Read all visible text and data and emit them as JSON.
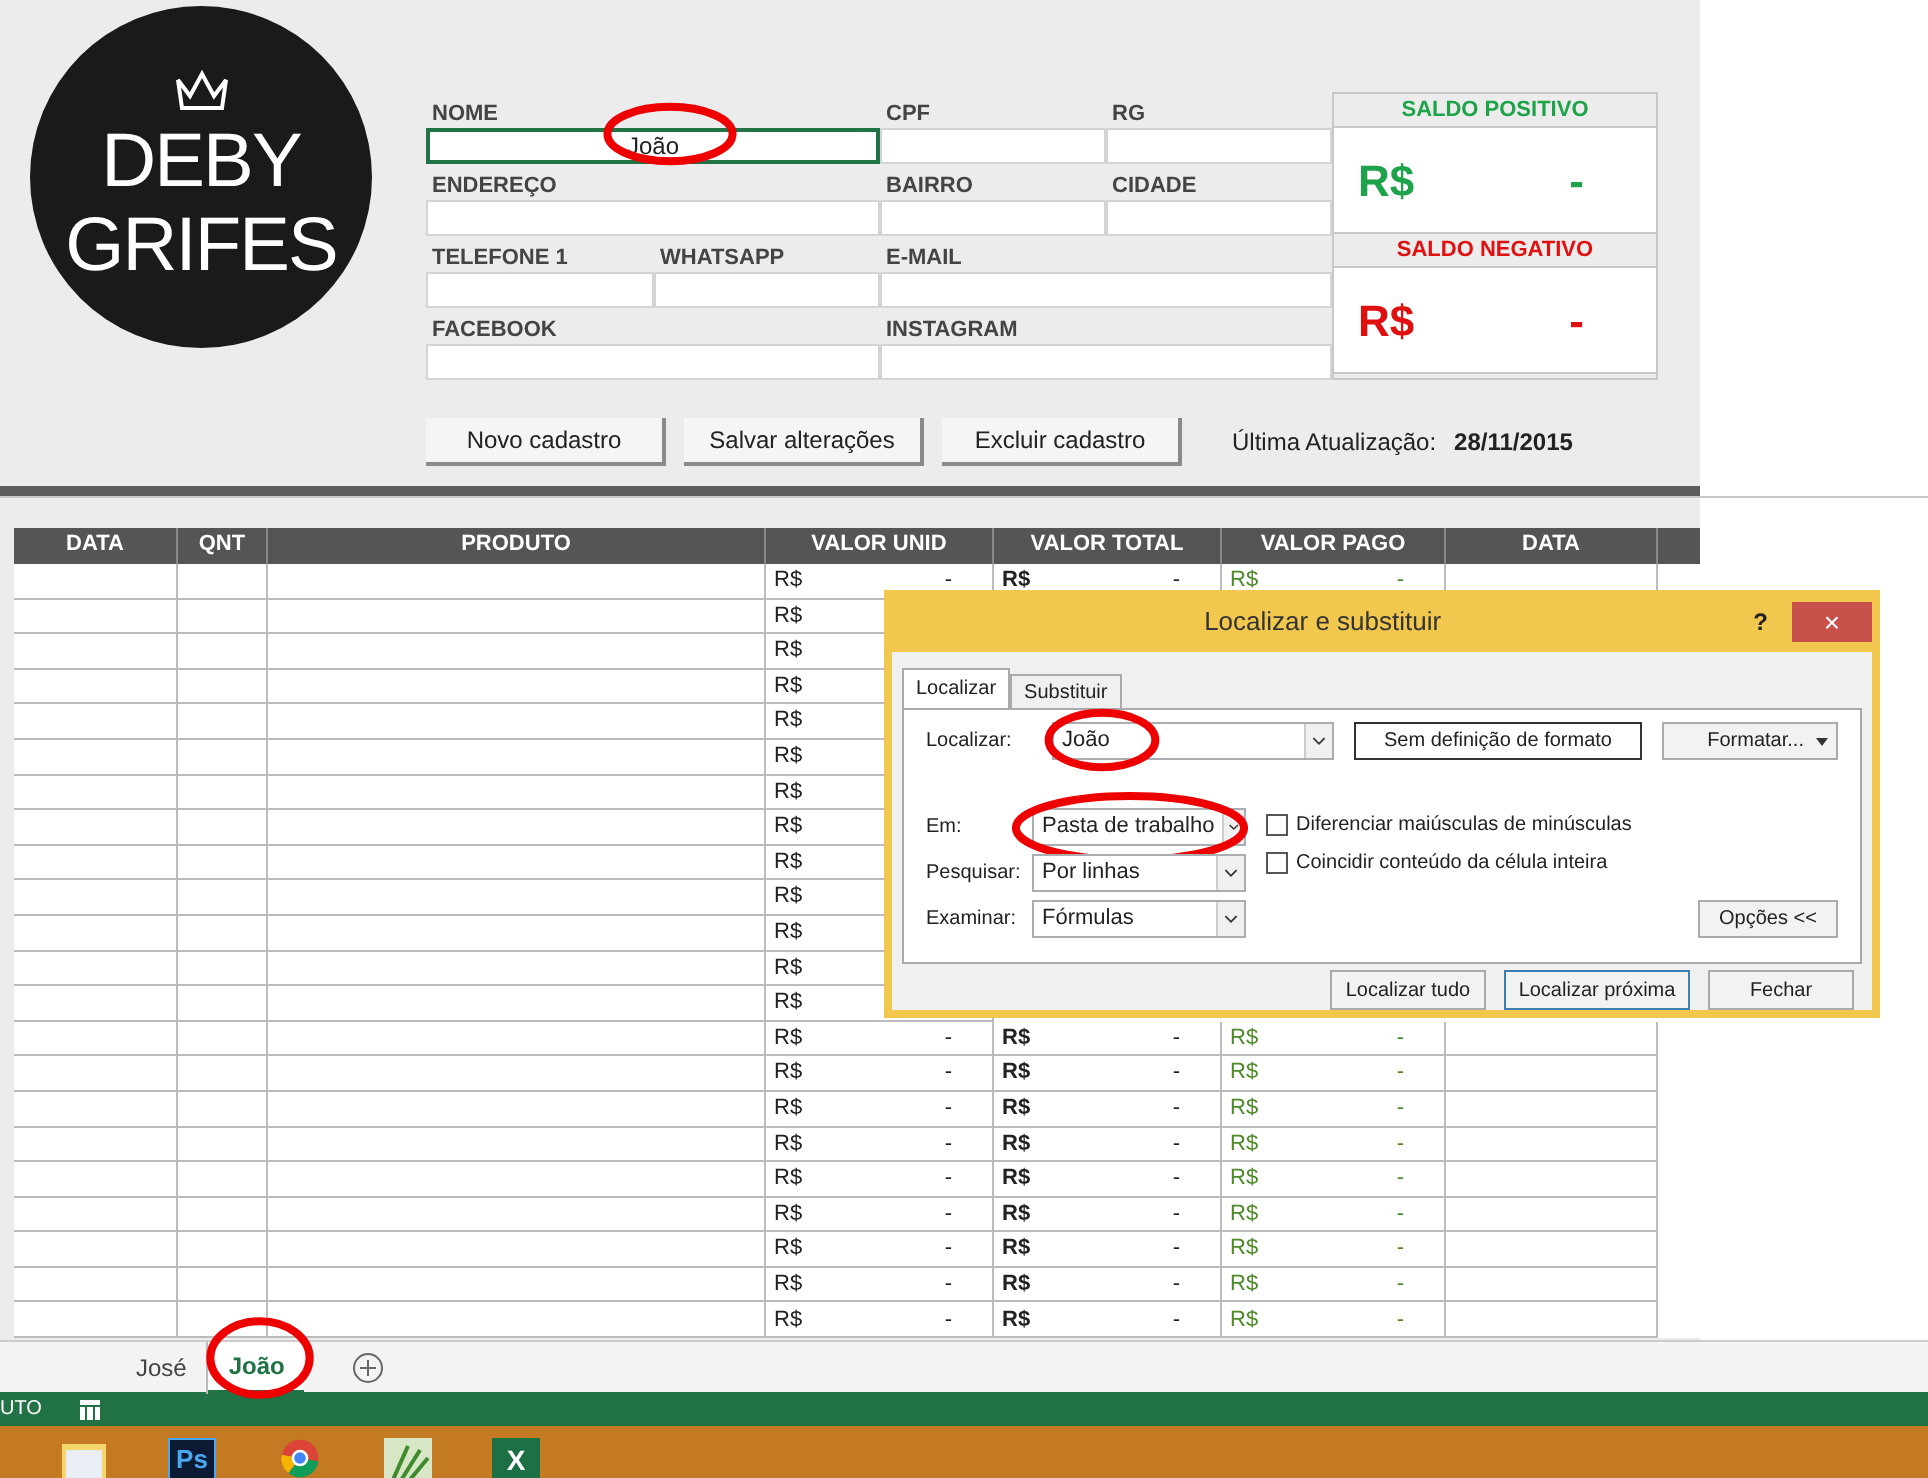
{
  "logo": {
    "lines": [
      "DEBY",
      "GRIFES"
    ]
  },
  "form": {
    "rows": [
      {
        "fields": [
          {
            "label": "NOME",
            "value": "João",
            "selected": true
          },
          {
            "label": "CPF",
            "selected": false
          },
          {
            "label": "RG",
            "selected": false
          }
        ]
      },
      {
        "fields": [
          {
            "label": "ENDEREÇO",
            "selected": false
          },
          {
            "label": "BAIRRO",
            "selected": false
          },
          {
            "label": "CIDADE",
            "selected": false
          }
        ]
      },
      {
        "fields": [
          {
            "label": "TELEFONE 1",
            "selected": false
          },
          {
            "label": "WHATSAPP",
            "selected": false
          },
          {
            "label": "E-MAIL",
            "selected": false
          }
        ]
      },
      {
        "fields": [
          {
            "label": "FACEBOOK",
            "selected": false
          },
          {
            "label": "INSTAGRAM",
            "selected": false
          }
        ]
      }
    ]
  },
  "balances": [
    {
      "title": "SALDO POSITIVO",
      "currency": "R$",
      "value": "-",
      "color": "#1fa34a"
    },
    {
      "title": "SALDO NEGATIVO",
      "currency": "R$",
      "value": "-",
      "color": "#e01010"
    }
  ],
  "buttons": [
    "Novo cadastro",
    "Salvar alterações",
    "Excluir cadastro"
  ],
  "last_update": {
    "label": "Última Atualização:",
    "date": "28/11/2015"
  },
  "table": {
    "columns": [
      "DATA",
      "QNT",
      "PRODUTO",
      "VALOR UNID",
      "VALOR TOTAL",
      "VALOR PAGO",
      "DATA"
    ],
    "rows": [
      {
        "unid": [
          "R$",
          "-"
        ],
        "total": [
          "R$",
          "-"
        ],
        "pago": [
          "R$",
          "-"
        ]
      },
      {
        "unid": [
          "R$"
        ]
      },
      {
        "unid": [
          "R$"
        ]
      },
      {
        "unid": [
          "R$"
        ]
      },
      {
        "unid": [
          "R$"
        ]
      },
      {
        "unid": [
          "R$"
        ]
      },
      {
        "unid": [
          "R$"
        ]
      },
      {
        "unid": [
          "R$"
        ]
      },
      {
        "unid": [
          "R$"
        ]
      },
      {
        "unid": [
          "R$"
        ]
      },
      {
        "unid": [
          "R$"
        ]
      },
      {
        "unid": [
          "R$"
        ]
      },
      {
        "unid": [
          "R$"
        ]
      },
      {
        "unid": [
          "R$",
          "-"
        ],
        "total": [
          "R$",
          "-"
        ],
        "pago": [
          "R$",
          "-"
        ]
      },
      {
        "unid": [
          "R$",
          "-"
        ],
        "total": [
          "R$",
          "-"
        ],
        "pago": [
          "R$",
          "-"
        ]
      },
      {
        "unid": [
          "R$",
          "-"
        ],
        "total": [
          "R$",
          "-"
        ],
        "pago": [
          "R$",
          "-"
        ]
      },
      {
        "unid": [
          "R$",
          "-"
        ],
        "total": [
          "R$",
          "-"
        ],
        "pago": [
          "R$",
          "-"
        ]
      },
      {
        "unid": [
          "R$",
          "-"
        ],
        "total": [
          "R$",
          "-"
        ],
        "pago": [
          "R$",
          "-"
        ]
      },
      {
        "unid": [
          "R$",
          "-"
        ],
        "total": [
          "R$",
          "-"
        ],
        "pago": [
          "R$",
          "-"
        ]
      },
      {
        "unid": [
          "R$",
          "-"
        ],
        "total": [
          "R$",
          "-"
        ],
        "pago": [
          "R$",
          "-"
        ]
      },
      {
        "unid": [
          "R$",
          "-"
        ],
        "total": [
          "R$",
          "-"
        ],
        "pago": [
          "R$",
          "-"
        ]
      },
      {
        "unid": [
          "R$",
          "-"
        ],
        "total": [
          "R$",
          "-"
        ],
        "pago": [
          "R$",
          "-"
        ]
      }
    ]
  },
  "dialog": {
    "title": "Localizar e substituir",
    "help": "?",
    "close": "×",
    "tabs": [
      {
        "label": "Localizar",
        "selected": true
      },
      {
        "label": "Substituir",
        "selected": false
      }
    ],
    "find": {
      "label": "Localizar:",
      "value": "João"
    },
    "format_status": "Sem definição de formato",
    "format_button": "Formatar...",
    "options": [
      {
        "label": "Em:",
        "value": "Pasta de trabalho"
      },
      {
        "label": "Pesquisar:",
        "value": "Por linhas"
      },
      {
        "label": "Examinar:",
        "value": "Fórmulas"
      }
    ],
    "checkboxes": [
      {
        "label": "Diferenciar maiúsculas de minúsculas",
        "checked": false
      },
      {
        "label": "Coincidir conteúdo da célula inteira",
        "checked": false
      }
    ],
    "options_button": "Opções <<",
    "actions": [
      {
        "label": "Localizar tudo",
        "selected": false
      },
      {
        "label": "Localizar próxima",
        "selected": true
      },
      {
        "label": "Fechar",
        "selected": false
      }
    ]
  },
  "sheet_tabs": [
    {
      "label": "José",
      "selected": false
    },
    {
      "label": "João",
      "selected": true
    }
  ],
  "status_bar": {
    "text": "UTO"
  },
  "taskbar": [
    {
      "kind": "folder"
    },
    {
      "kind": "ps",
      "text": "Ps"
    },
    {
      "kind": "chrome"
    },
    {
      "kind": "plant"
    },
    {
      "kind": "excel",
      "text": "X"
    }
  ]
}
